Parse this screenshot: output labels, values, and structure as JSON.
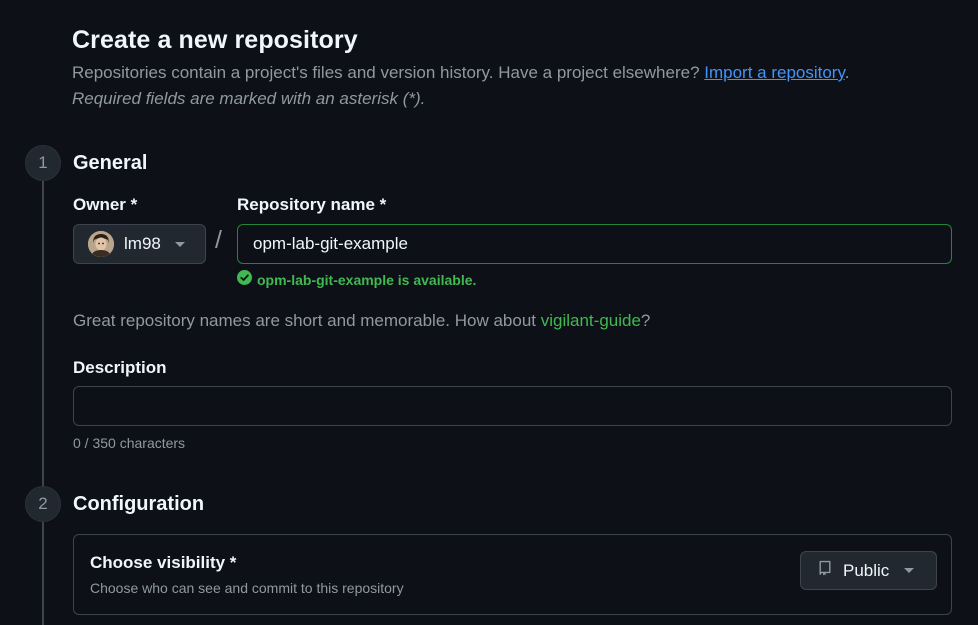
{
  "header": {
    "title": "Create a new repository",
    "subtitle_text": "Repositories contain a project's files and version history. Have a project elsewhere? ",
    "import_link": "Import a repository",
    "subtitle_period": ".",
    "required_note": "Required fields are marked with an asterisk (*)."
  },
  "general": {
    "step_number": "1",
    "title": "General",
    "owner_label": "Owner *",
    "owner_value": "lm98",
    "slash": "/",
    "repo_name_label": "Repository name *",
    "repo_name_value": "opm-lab-git-example",
    "availability": "opm-lab-git-example is available.",
    "suggestion_prefix": "Great repository names are short and memorable. How about ",
    "suggestion_link": "vigilant-guide",
    "suggestion_suffix": "?",
    "description_label": "Description",
    "description_value": "",
    "char_count": "0 / 350 characters"
  },
  "configuration": {
    "step_number": "2",
    "title": "Configuration",
    "visibility_label": "Choose visibility *",
    "visibility_description": "Choose who can see and commit to this repository",
    "visibility_value": "Public"
  },
  "icons": {
    "owner_avatar": "avatar",
    "owner_caret": "chevron-down-icon",
    "availability": "check-circle-icon",
    "visibility": "repo-icon",
    "visibility_caret": "chevron-down-icon"
  },
  "colors": {
    "background": "#0d1117",
    "text": "#f0f6fc",
    "muted": "#9198a1",
    "link": "#4493f8",
    "success": "#3fb950",
    "border": "#3d444d"
  }
}
